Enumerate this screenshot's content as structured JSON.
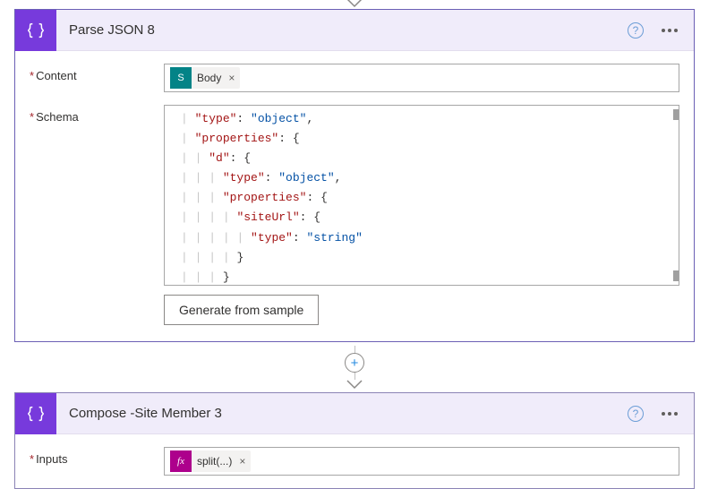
{
  "card1": {
    "title": "Parse JSON 8",
    "content_label": "Content",
    "schema_label": "Schema",
    "content_token": {
      "label": "Body",
      "icon": "sp",
      "icon_text": "S"
    },
    "schema_lines": [
      [
        {
          "t": "guide",
          "v": "  "
        },
        {
          "t": "key",
          "v": "\"type\""
        },
        {
          "t": "pun",
          "v": ": "
        },
        {
          "t": "str",
          "v": "\"object\""
        },
        {
          "t": "pun",
          "v": ","
        }
      ],
      [
        {
          "t": "guide",
          "v": "  "
        },
        {
          "t": "key",
          "v": "\"properties\""
        },
        {
          "t": "pun",
          "v": ": "
        },
        {
          "t": "br",
          "v": "{"
        }
      ],
      [
        {
          "t": "guide",
          "v": "    "
        },
        {
          "t": "key",
          "v": "\"d\""
        },
        {
          "t": "pun",
          "v": ": "
        },
        {
          "t": "br",
          "v": "{"
        }
      ],
      [
        {
          "t": "guide",
          "v": "      "
        },
        {
          "t": "key",
          "v": "\"type\""
        },
        {
          "t": "pun",
          "v": ": "
        },
        {
          "t": "str",
          "v": "\"object\""
        },
        {
          "t": "pun",
          "v": ","
        }
      ],
      [
        {
          "t": "guide",
          "v": "      "
        },
        {
          "t": "key",
          "v": "\"properties\""
        },
        {
          "t": "pun",
          "v": ": "
        },
        {
          "t": "br",
          "v": "{"
        }
      ],
      [
        {
          "t": "guide",
          "v": "        "
        },
        {
          "t": "key",
          "v": "\"siteUrl\""
        },
        {
          "t": "pun",
          "v": ": "
        },
        {
          "t": "br",
          "v": "{"
        }
      ],
      [
        {
          "t": "guide",
          "v": "          "
        },
        {
          "t": "key",
          "v": "\"type\""
        },
        {
          "t": "pun",
          "v": ": "
        },
        {
          "t": "str",
          "v": "\"string\""
        }
      ],
      [
        {
          "t": "guide",
          "v": "        "
        },
        {
          "t": "br",
          "v": "}"
        }
      ],
      [
        {
          "t": "guide",
          "v": "      "
        },
        {
          "t": "br",
          "v": "}"
        }
      ]
    ],
    "generate_button": "Generate from sample"
  },
  "card2": {
    "title": "Compose -Site Member 3",
    "inputs_label": "Inputs",
    "inputs_token": {
      "label": "split(...)",
      "icon": "fx",
      "icon_text": "fx"
    }
  },
  "ui": {
    "help": "?",
    "remove": "×",
    "required": "*",
    "add": "+"
  }
}
